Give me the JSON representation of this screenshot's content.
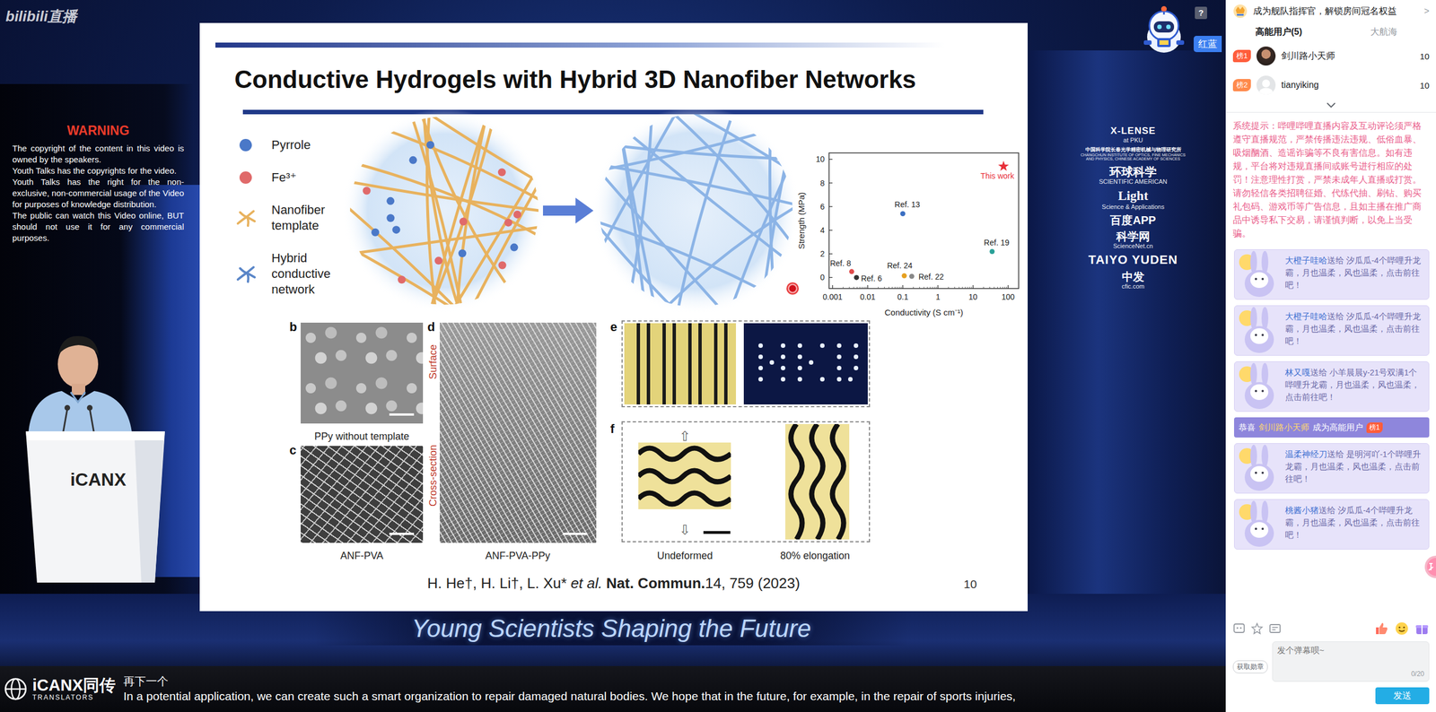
{
  "header": {
    "logo": "bilibili直播",
    "help": "?",
    "event_label": "红蓝"
  },
  "warning": {
    "title": "WARNING",
    "paragraphs": [
      "The copyright of the content in this video is owned by the speakers.",
      "Youth Talks has the copyrights for the video.",
      "Youth Talks has the right for the non-exclusive, non-commercial usage of the Video for purposes of knowledge distribution.",
      "The public can watch this Video online, BUT should not use it for any commercial purposes."
    ]
  },
  "slide": {
    "title": "Conductive Hydrogels with Hybrid 3D Nanofiber Networks",
    "legend": [
      {
        "label": "Pyrrole",
        "kind": "dot",
        "color": "#4a78c8"
      },
      {
        "label": "Fe³⁺",
        "kind": "dot",
        "color": "#e06a6a"
      },
      {
        "label": "Nanofiber template",
        "kind": "fiber",
        "color": "#e8b25e"
      },
      {
        "label": "Hybrid conductive network",
        "kind": "fiber",
        "color": "#5a86c8"
      }
    ],
    "chart": {
      "y_label": "Strength (MPa)",
      "x_label": "Conductivity (S cm⁻¹)",
      "y_ticks": [
        "0",
        "2",
        "4",
        "6",
        "8",
        "10"
      ],
      "x_ticks": [
        "0.001",
        "0.01",
        "0.1",
        "1",
        "10",
        "100"
      ],
      "points": [
        {
          "label": "This work",
          "x": 74,
          "y": 9.4,
          "kind": "star",
          "color": "#e8303a"
        },
        {
          "label": "Ref. 13",
          "x": 0.1,
          "y": 5.4,
          "kind": "dot",
          "color": "#3b6fc2"
        },
        {
          "label": "Ref. 19",
          "x": 35,
          "y": 2.2,
          "kind": "dot",
          "color": "#2aa198"
        },
        {
          "label": "Ref. 8",
          "x": 0.0035,
          "y": 0.5,
          "kind": "dot",
          "color": "#e04b4b"
        },
        {
          "label": "Ref. 6",
          "x": 0.0048,
          "y": 0,
          "kind": "dot",
          "color": "#333333"
        },
        {
          "label": "Ref. 24",
          "x": 0.11,
          "y": 0.15,
          "kind": "dot",
          "color": "#e6a020"
        },
        {
          "label": "Ref. 22",
          "x": 0.18,
          "y": 0.1,
          "kind": "dot",
          "color": "#888888"
        }
      ]
    },
    "panels": [
      {
        "letter": "b",
        "caption": "PPy without template"
      },
      {
        "letter": "c",
        "caption": "ANF-PVA"
      },
      {
        "letter": "d",
        "caption": "ANF-PVA-PPy",
        "side_labels": [
          "Surface",
          "Cross-section"
        ]
      },
      {
        "letter": "e"
      },
      {
        "letter": "f",
        "captions": [
          "Undeformed",
          "80% elongation"
        ],
        "arrows": [
          "⇧",
          "⇩"
        ]
      }
    ],
    "citation": {
      "authors": "H. He†, H. Li†, L. Xu*",
      "etal": "et al.",
      "journal": "Nat. Commun.",
      "ref": "14, 759 (2023)"
    },
    "page": "10"
  },
  "sponsors": [
    {
      "main": "X-LENSE",
      "sub": "at PKU"
    },
    {
      "main": "中国科学院长春光学精密机械与物理研究所",
      "sub": "CHANGCHUN INSTITUTE OF OPTICS, FINE MECHANICS AND PHYSICS, CHINESE ACADEMY OF SCIENCES"
    },
    {
      "main": "环球科学",
      "sub": "SCIENTIFIC AMERICAN"
    },
    {
      "main": "Light",
      "sub": "Science & Applications"
    },
    {
      "main": "百度APP"
    },
    {
      "main": "科学网",
      "sub": "ScienceNet.cn"
    },
    {
      "main": "TAIYO YUDEN"
    },
    {
      "main": "中发",
      "sub": "cfic.com"
    }
  ],
  "podium": {
    "label": "iCANX"
  },
  "banner": "Young Scientists Shaping the Future",
  "subtitle": {
    "logo_main": "iCANX同传",
    "logo_sub": "TRANSLATORS",
    "chinese": "再下一个",
    "english": "In a potential application, we can create such a smart organization to repair damaged natural bodies. We hope that in the future, for example, in the repair of sports injuries,"
  },
  "sidebar": {
    "promo": {
      "text": "成为舰队指挥官，解锁房间冠名权益",
      "arrow": ">"
    },
    "tabs": [
      {
        "label": "高能用户(5)",
        "selected": true
      },
      {
        "label": "大航海",
        "selected": false
      }
    ],
    "users": [
      {
        "rank": "榜1",
        "name": "剑川路小天师",
        "score": "10",
        "color": "#ff5d3b",
        "kind": "photo"
      },
      {
        "rank": "榜2",
        "name": "tianyiking",
        "score": "10",
        "color": "#ff8a4c",
        "kind": "default"
      }
    ],
    "notice": "系统提示：哔哩哔哩直播内容及互动评论须严格遵守直播规范，严禁传播违法违规、低俗血暴、吸烟酗酒、造谣诈骗等不良有害信息。如有违规，平台将对违规直播间或账号进行相应的处罚！注意理性打赏，严禁未成年人直播或打赏。请勿轻信各类招聘征婚、代练代抽、刷钻、购买礼包码、游戏币等广告信息，且如主播在推广商品中诱导私下交易，请谨慎判断，以免上当受骗。",
    "messages": [
      {
        "kind": "gift",
        "sender": "大橙子哇哈",
        "text": "送给 汐瓜瓜-4个哔哩升龙霸，月也温柔，风也温柔，点击前往吧！"
      },
      {
        "kind": "gift",
        "sender": "大橙子哇哈",
        "text": "送给 汐瓜瓜-4个哔哩升龙霸，月也温柔，风也温柔，点击前往吧！"
      },
      {
        "kind": "gift",
        "sender": "林又嘎",
        "text": "送给 小羊晨晨y-21号双满1个哔哩升龙霸，月也温柔，风也温柔，点击前往吧！"
      },
      {
        "kind": "congrats",
        "prefix": "恭喜",
        "user": "剑川路小天师",
        "text": "成为高能用户",
        "badge": "榜1"
      },
      {
        "kind": "gift",
        "sender": "温柔神经刀",
        "text": "送给 是明河吖-1个哔哩升龙霸，月也温柔，风也温柔，点击前往吧！"
      },
      {
        "kind": "gift",
        "sender": "桃酱小猪",
        "text": "送给 汐瓜瓜-4个哔哩升龙霸，月也温柔，风也温柔，点击前往吧！"
      }
    ],
    "medal_button": "获取勋章",
    "input": {
      "placeholder": "发个弹幕呗~",
      "counter": "0/20"
    },
    "send": "发送"
  }
}
